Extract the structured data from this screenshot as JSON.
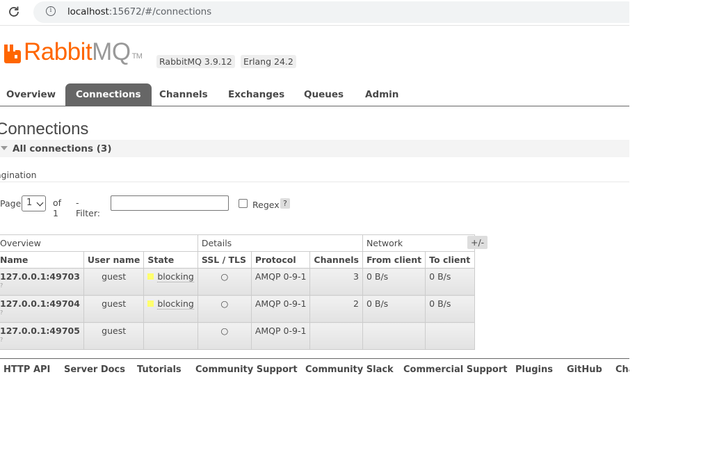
{
  "browser": {
    "url_host": "localhost",
    "url_rest": ":15672/#/connections"
  },
  "header": {
    "logo_rabbit": "Rabbit",
    "logo_mq": "MQ",
    "logo_tm": "TM",
    "version_badge": "RabbitMQ 3.9.12",
    "erlang_badge": "Erlang 24.2"
  },
  "tabs": [
    {
      "label": "Overview",
      "active": false
    },
    {
      "label": "Connections",
      "active": true
    },
    {
      "label": "Channels",
      "active": false
    },
    {
      "label": "Exchanges",
      "active": false
    },
    {
      "label": "Queues",
      "active": false
    },
    {
      "label": "Admin",
      "active": false
    }
  ],
  "page": {
    "title": "Connections",
    "section_title": "All connections (3)"
  },
  "pagination": {
    "heading": "agination",
    "page_label": "Page",
    "page_value": "1",
    "of_label": "of 1",
    "filter_label": "- Filter:",
    "filter_value": "",
    "regex_label": "Regex",
    "help": "?"
  },
  "table": {
    "groups": [
      "Overview",
      "Details",
      "Network"
    ],
    "columns": [
      "Name",
      "User name",
      "State",
      "SSL / TLS",
      "Protocol",
      "Channels",
      "From client",
      "To client"
    ],
    "toggle": "+/-",
    "rows": [
      {
        "name": "127.0.0.1:49703",
        "q": "?",
        "user": "guest",
        "state": "blocking",
        "ssl": "○",
        "protocol": "AMQP 0-9-1",
        "channels": "3",
        "from": "0 B/s",
        "to": "0 B/s"
      },
      {
        "name": "127.0.0.1:49704",
        "q": "?",
        "user": "guest",
        "state": "blocking",
        "ssl": "○",
        "protocol": "AMQP 0-9-1",
        "channels": "2",
        "from": "0 B/s",
        "to": "0 B/s"
      },
      {
        "name": "127.0.0.1:49705",
        "q": "?",
        "user": "guest",
        "state": "",
        "ssl": "○",
        "protocol": "AMQP 0-9-1",
        "channels": "",
        "from": "",
        "to": ""
      }
    ]
  },
  "footer": {
    "links": [
      "HTTP API",
      "Server Docs",
      "Tutorials",
      "Community Support",
      "Community Slack",
      "Commercial Support",
      "Plugins",
      "GitHub",
      "Cha"
    ]
  },
  "colors": {
    "brand_orange": "#ff6600",
    "tab_active_bg": "#666666",
    "blocking_indicator": "#ffff6e"
  }
}
